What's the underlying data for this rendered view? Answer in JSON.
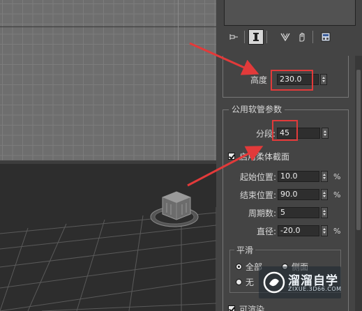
{
  "panel": {
    "height_label": "高度",
    "height_value": "230.0",
    "common_group_title": "公用软管参数",
    "segments_label": "分段:",
    "segments_value": "45",
    "flex_section_label": "启用柔体截面",
    "start_pos_label": "起始位置:",
    "start_pos_value": "10.0",
    "end_pos_label": "结束位置:",
    "end_pos_value": "90.0",
    "cycles_label": "周期数:",
    "cycles_value": "5",
    "diameter_label": "直径:",
    "diameter_value": "-20.0",
    "percent": "%",
    "smooth_group_title": "平滑",
    "smooth_all": "全部",
    "smooth_sides": "侧面",
    "smooth_none": "无",
    "renderable_label": "可渲染"
  },
  "watermark": {
    "title": "溜溜自学",
    "subtitle": "ZIXUE.3D66.COM"
  },
  "colors": {
    "highlight": "#e23a3a",
    "arrow": "#e23a3a"
  },
  "icons": [
    "pin-icon",
    "modifier-stack-icon",
    "funnel-icon",
    "hand-icon",
    "configure-icon"
  ]
}
